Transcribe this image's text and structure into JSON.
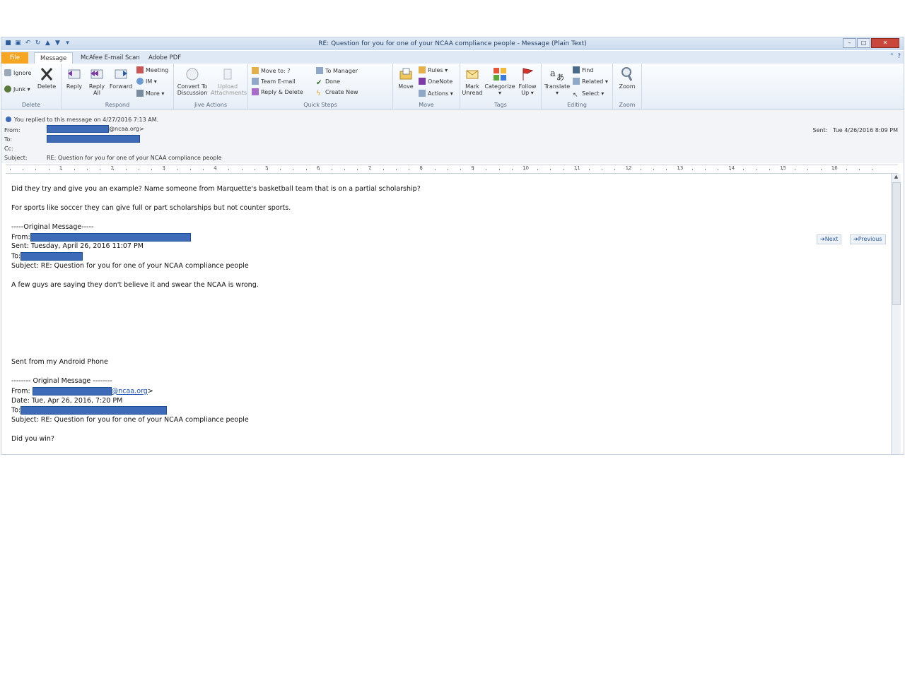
{
  "window": {
    "title": "RE: Question for you for one of your NCAA compliance people  -  Message (Plain Text)"
  },
  "tabs": {
    "file": "File",
    "message": "Message",
    "mcafee": "McAfee E-mail Scan",
    "adobe": "Adobe PDF"
  },
  "ribbon": {
    "delete": {
      "ignore": "Ignore",
      "junk": "Junk",
      "delete": "Delete",
      "group": "Delete"
    },
    "respond": {
      "reply": "Reply",
      "reply_all_1": "Reply",
      "reply_all_2": "All",
      "forward": "Forward",
      "meeting": "Meeting",
      "im": "IM",
      "more": "More",
      "group": "Respond"
    },
    "live": {
      "convert_1": "Convert To",
      "convert_2": "Discussion",
      "upload_1": "Upload",
      "upload_2": "Attachments",
      "group": "Jive Actions"
    },
    "quick": {
      "move_to": "Move to: ?",
      "team_email": "Team E-mail",
      "reply_delete": "Reply & Delete",
      "to_manager": "To Manager",
      "done": "Done",
      "create_new": "Create New",
      "group": "Quick Steps"
    },
    "move": {
      "move": "Move",
      "rules": "Rules",
      "onenote": "OneNote",
      "actions": "Actions",
      "group": "Move"
    },
    "tags": {
      "mark_1": "Mark",
      "mark_2": "Unread",
      "categorize": "Categorize",
      "follow_1": "Follow",
      "follow_2": "Up",
      "group": "Tags"
    },
    "editing": {
      "translate": "Translate",
      "find": "Find",
      "related": "Related",
      "select": "Select",
      "group": "Editing"
    },
    "zoom": {
      "zoom": "Zoom",
      "group": "Zoom"
    }
  },
  "header": {
    "replied_info": "You replied to this message on 4/27/2016 7:13 AM.",
    "from_label": "From:",
    "from_suffix": "@ncaa.org>",
    "to_label": "To:",
    "cc_label": "Cc:",
    "subject_label": "Subject:",
    "subject": "RE: Question for you for one of your NCAA compliance people",
    "sent_label": "Sent:",
    "sent_value": "Tue 4/26/2016 8:09 PM"
  },
  "ruler": {
    "numbers": [
      "1",
      "2",
      "3",
      "4",
      "5",
      "6",
      "7",
      "8",
      "9",
      "10",
      "11",
      "12",
      "13",
      "14",
      "15",
      "16"
    ]
  },
  "body": {
    "l1": "Did they try and give you an example? Name someone from Marquette's basketball team that is on a partial scholarship?",
    "l2": "For sports like soccer they can give full or part scholarships but not counter sports.",
    "l3": "-----Original Message-----",
    "l4_label": "From:",
    "l5": "Sent: Tuesday, April 26, 2016 11:07 PM",
    "l6_label": "To:",
    "l7": "Subject: RE: Question for you for one of your NCAA compliance people",
    "l8": "A few guys are saying they don't believe it and swear the NCAA is wrong.",
    "l9": "Sent from my Android Phone",
    "l10": "-------- Original Message --------",
    "l11_label": "From:",
    "l11_link": "@ncaa.org",
    "l11_end": ">",
    "l12": "Date: Tue, Apr 26, 2016, 7:20 PM",
    "l13_label": "To:",
    "l14": "Subject: RE: Question for you for one of your NCAA compliance people",
    "l15": "Did you win?"
  },
  "nav": {
    "next": "Next",
    "previous": "Previous"
  },
  "colors": {
    "accent": "#2a5b9e",
    "file_tab": "#f6a623",
    "redaction": "#3d6bb8"
  }
}
